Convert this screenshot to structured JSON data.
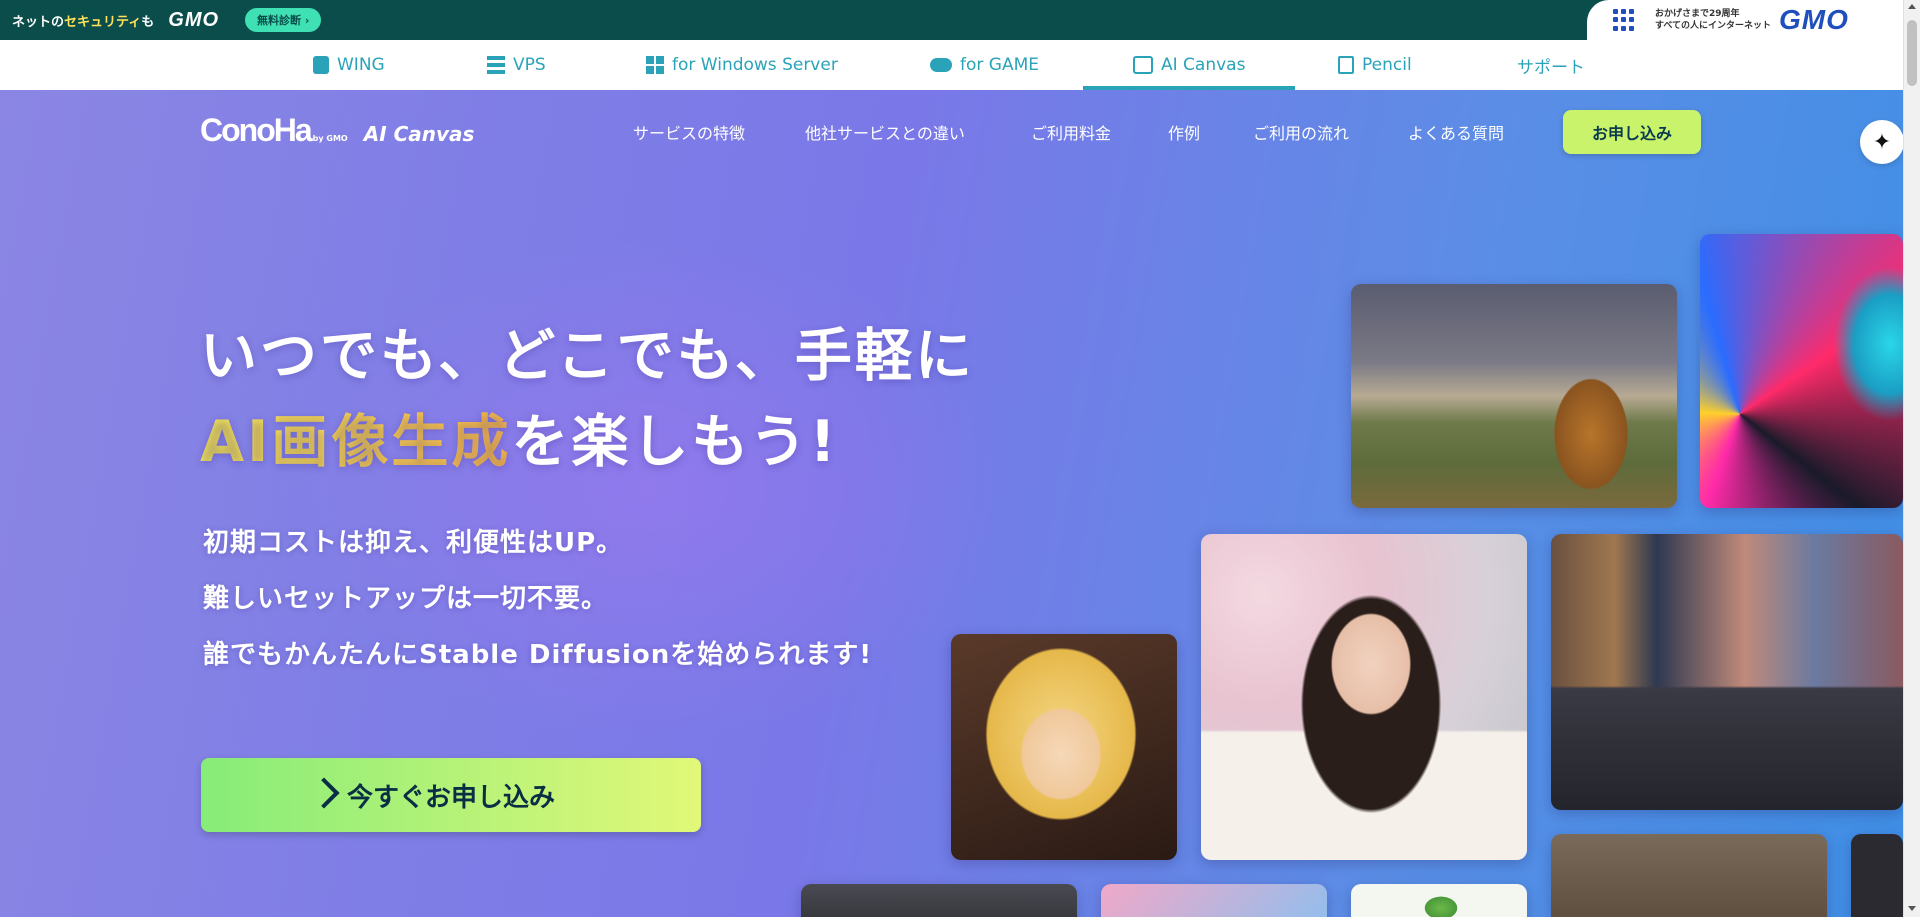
{
  "gmo_bar": {
    "slogan_prefix": "ネットの",
    "slogan_highlight": "セキュリティ",
    "slogan_suffix": "も",
    "logo": "GMO",
    "diagnosis_pill": "無料診断 ›",
    "anniversary_line1": "おかげさまで29周年",
    "anniversary_line2": "すべての人にインターネット",
    "right_logo": "GMO"
  },
  "product_nav": {
    "tabs": [
      {
        "label": "WING",
        "icon": "server-stack-icon"
      },
      {
        "label": "VPS",
        "icon": "server-icon"
      },
      {
        "label": "for Windows Server",
        "icon": "windows-icon"
      },
      {
        "label": "for GAME",
        "icon": "gamepad-icon"
      },
      {
        "label": "AI Canvas",
        "icon": "image-icon",
        "active": true
      },
      {
        "label": "Pencil",
        "icon": "pencil-icon"
      },
      {
        "label": "サポート"
      }
    ]
  },
  "site_nav": {
    "brand_main": "ConoHa",
    "brand_by": "by GMO",
    "brand_sub": "AI Canvas",
    "links": [
      "サービスの特徴",
      "他社サービスとの違い",
      "ご利用料金",
      "作例",
      "ご利用の流れ",
      "よくある質問"
    ],
    "apply_button": "お申し込み",
    "sparkle_icon": "sparkle-icon"
  },
  "hero": {
    "headline_line1": "いつでも、どこでも、手軽に",
    "headline_accent": "AI画像生成",
    "headline_line2_rest": "を楽しもう!",
    "sub_lines": [
      "初期コストは抑え、利便性はUP。",
      "難しいセットアップは一切不要。",
      "誰でもかんたんにStable Diffusionを始められます!"
    ],
    "cta_label": "今すぐお申し込み"
  },
  "colors": {
    "gmo_bar_bg": "#0a4d4a",
    "tab_accent": "#2aa3b8",
    "apply_button_bg": "#c9f36a",
    "headline_accent_start": "#f4e85a",
    "headline_accent_end": "#f6b84a"
  }
}
